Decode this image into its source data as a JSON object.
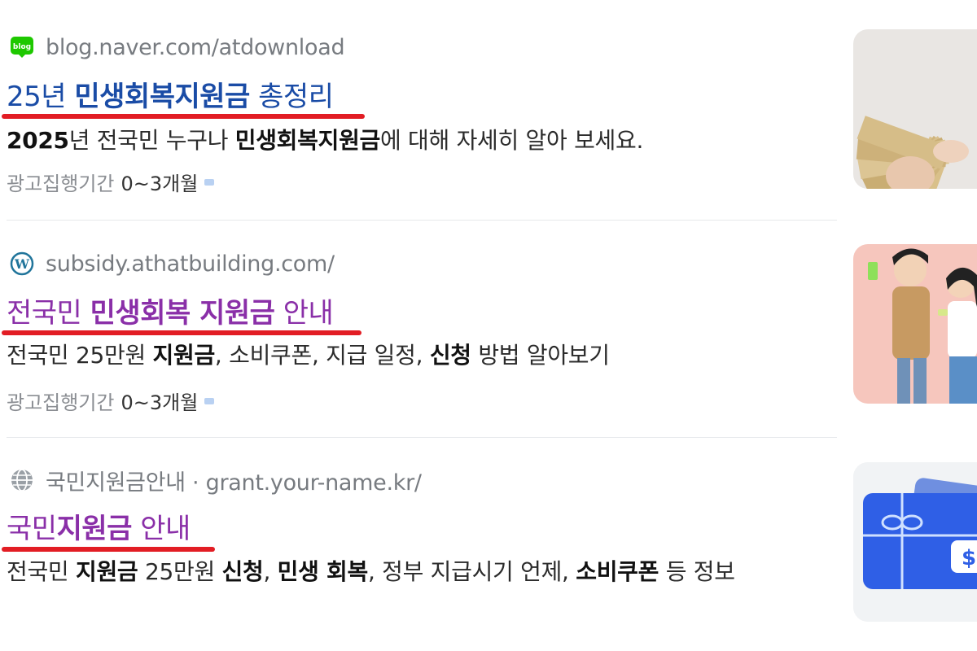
{
  "results": [
    {
      "source": "blog.naver.com/atdownload",
      "source_icon": "naver-blog-icon",
      "title_plain_a": "25년 ",
      "title_bold": "민생회복지원금",
      "title_plain_b": " 총정리",
      "desc": {
        "b1": "2025",
        "t1": "년 전국민 누구나 ",
        "b2": "민생회복지원금",
        "t2": "에 대해 자세히 알아 보세요."
      },
      "ad_label": "광고집행기간",
      "ad_value": "0~3개월",
      "title_color": "#1a4ca6",
      "thumbnail": "cash-banknotes-photo"
    },
    {
      "source": "subsidy.athatbuilding.com/",
      "source_icon": "wordpress-icon",
      "title_plain_a": "전국민 ",
      "title_bold": "민생회복 지원금",
      "title_plain_b": " 안내",
      "desc": {
        "t1": "전국민 25만원 ",
        "b1": "지원금",
        "t2": ", 소비쿠폰, 지급 일정, ",
        "b2": "신청",
        "t3": " 방법 알아보기"
      },
      "ad_label": "광고집행기간",
      "ad_value": "0~3개월",
      "title_color": "#8a2fa8",
      "thumbnail": "happy-couple-illustration"
    },
    {
      "source": "국민지원금안내 · grant.your-name.kr/",
      "source_icon": "globe-icon",
      "title_plain_a": "국민",
      "title_bold": "지원금",
      "title_plain_b": " 안내",
      "desc": {
        "t1": "전국민 ",
        "b1": "지원금",
        "t2": " 25만원 ",
        "b2": "신청",
        "t3": ", ",
        "b3": "민생 회복",
        "t4": ", 정부 지급시기 언제, ",
        "b4": "소비쿠폰",
        "t5": " 등 정보"
      },
      "title_color": "#8a2fa8",
      "thumbnail": "blue-gift-card-illustration"
    }
  ],
  "underline_color": "#e21d24"
}
